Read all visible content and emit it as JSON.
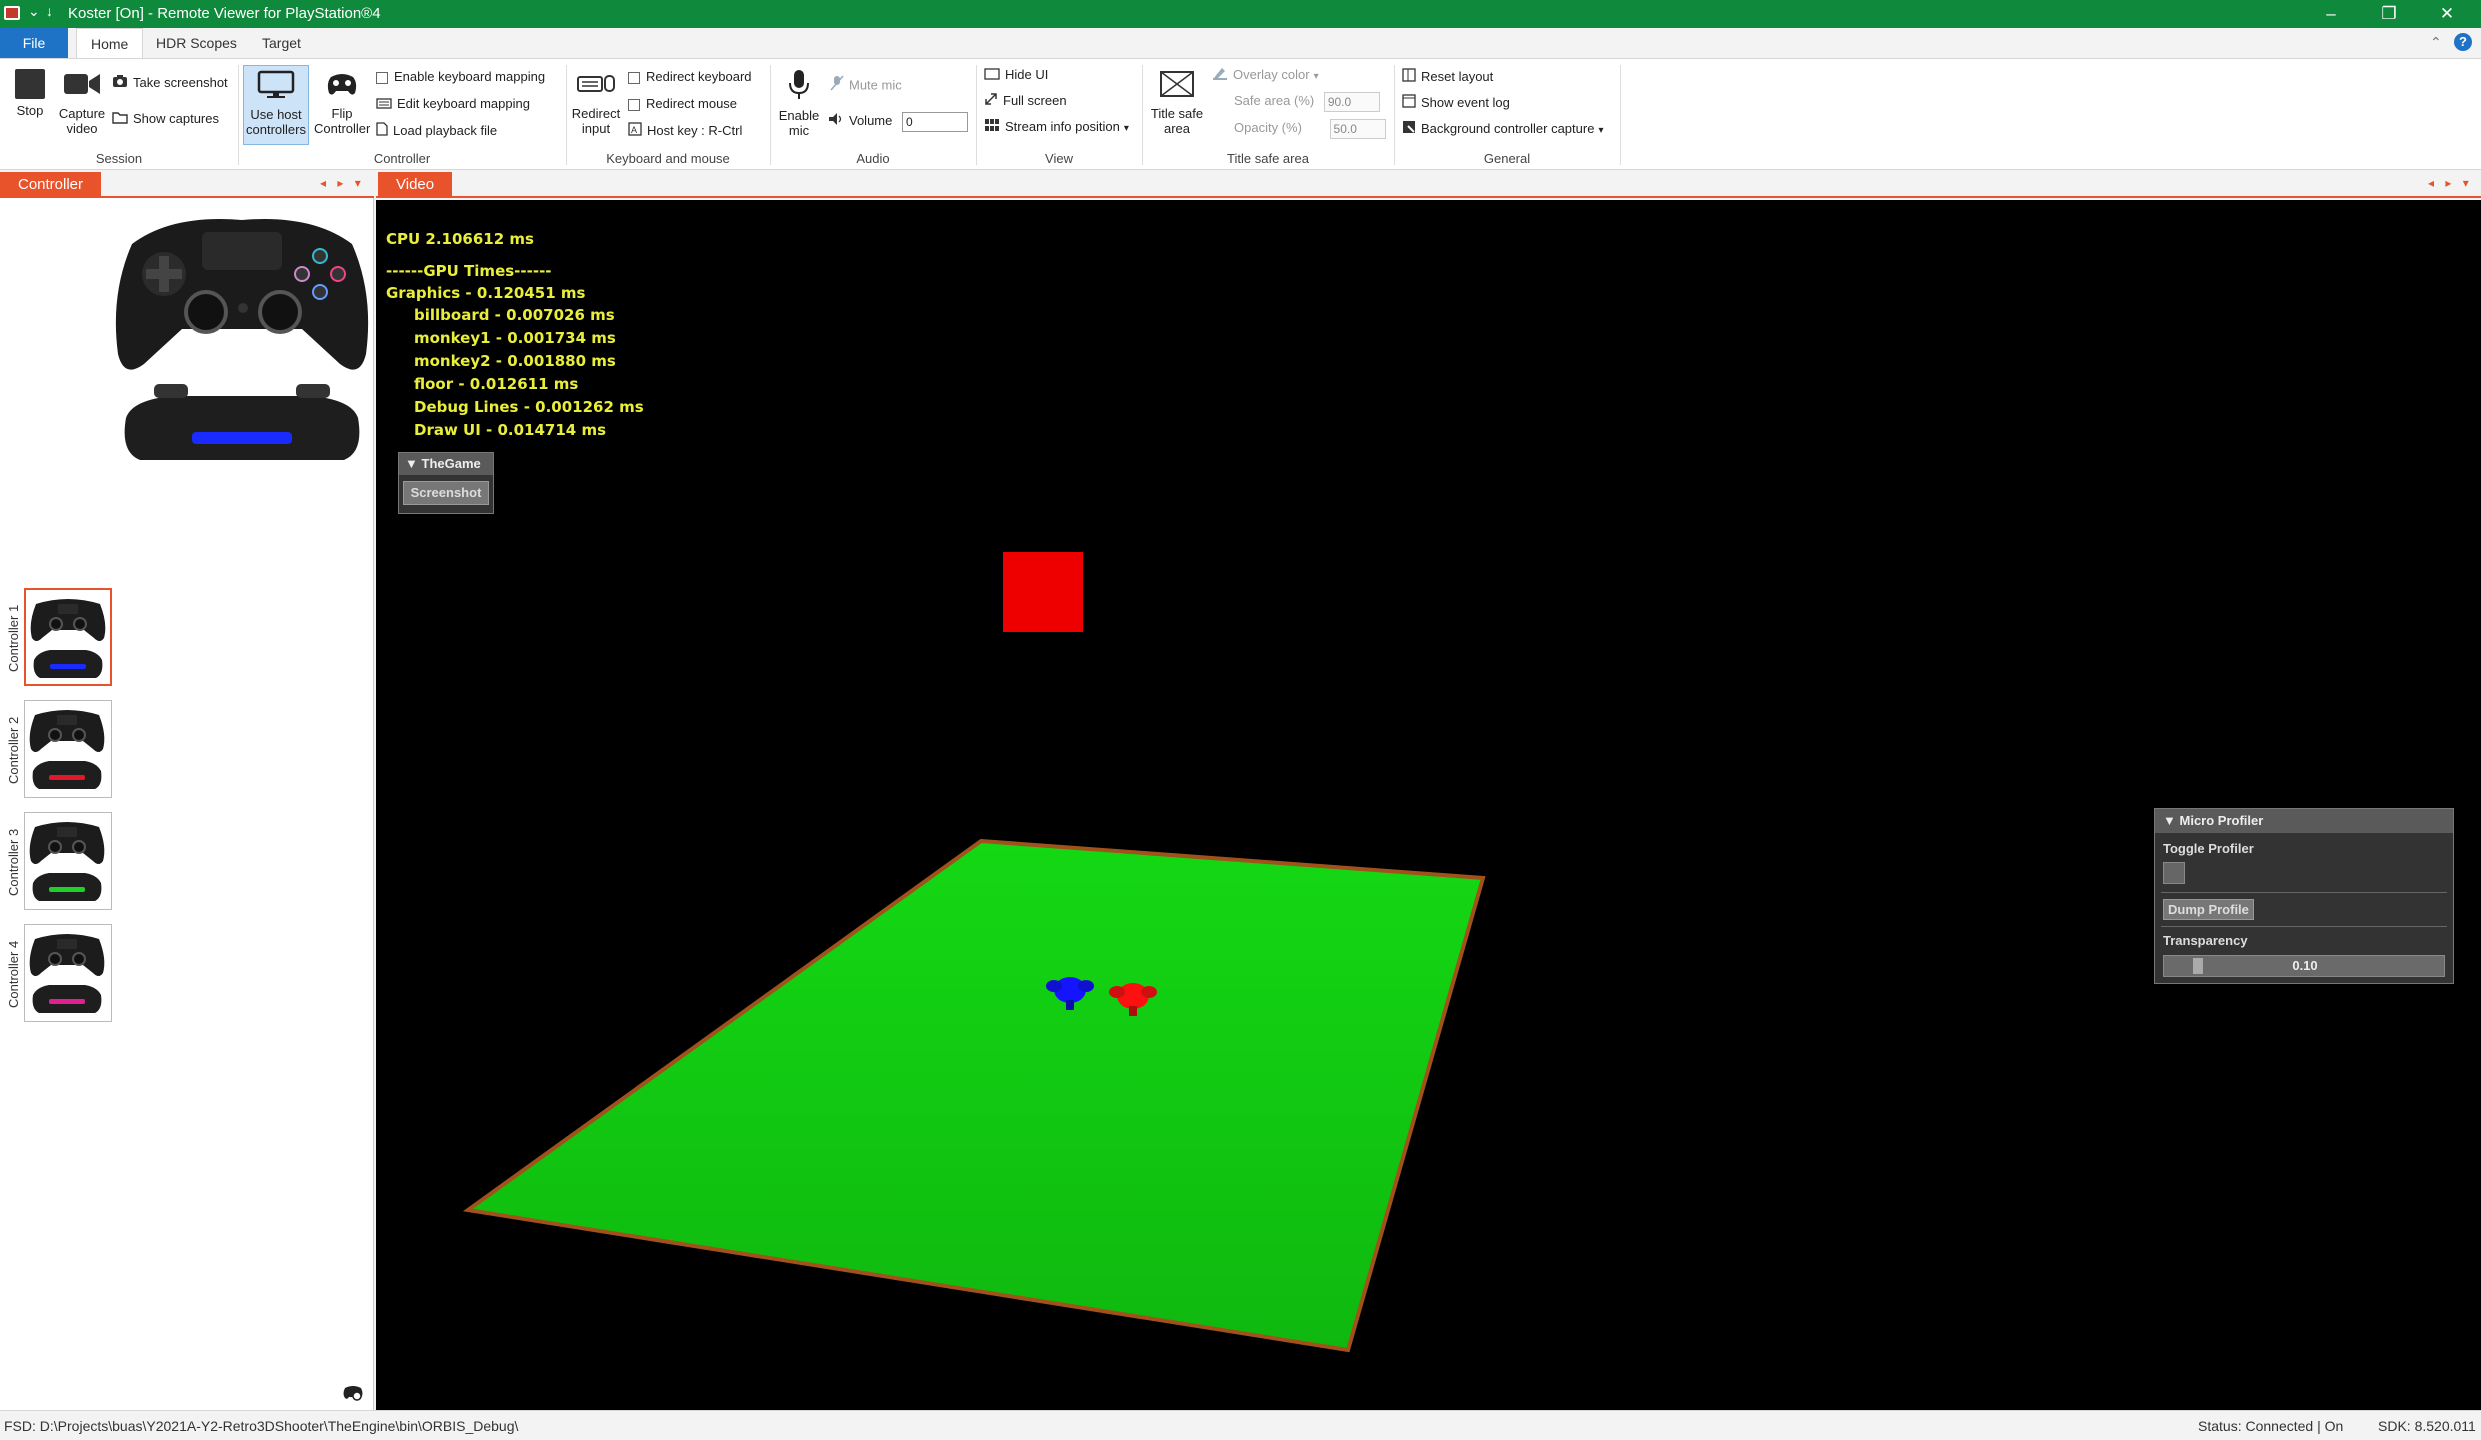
{
  "window": {
    "title": "Koster [On] - Remote Viewer for PlayStation®4",
    "quick_access": "⌄",
    "quick_access2": "↓"
  },
  "tabs": {
    "file": "File",
    "home": "Home",
    "hdr": "HDR Scopes",
    "target": "Target"
  },
  "ribbon": {
    "session": {
      "label": "Session",
      "stop": "Stop",
      "capture_video": "Capture video",
      "take_screenshot": "Take screenshot",
      "show_captures": "Show captures"
    },
    "controller": {
      "label": "Controller",
      "use_host": "Use host controllers",
      "flip": "Flip Controller",
      "enable_kb_map": "Enable keyboard mapping",
      "edit_kb_map": "Edit keyboard mapping",
      "load_playback": "Load playback file"
    },
    "kbm": {
      "label": "Keyboard and mouse",
      "redirect_input": "Redirect input",
      "redirect_keyboard": "Redirect keyboard",
      "redirect_mouse": "Redirect mouse",
      "host_key": "Host key : R-Ctrl"
    },
    "audio": {
      "label": "Audio",
      "enable_mic": "Enable mic",
      "mute_mic": "Mute mic",
      "volume_label": "Volume",
      "volume_value": "0"
    },
    "view": {
      "label": "View",
      "hide_ui": "Hide UI",
      "full_screen": "Full screen",
      "stream_info": "Stream info position"
    },
    "title_safe": {
      "label": "Title safe area",
      "button": "Title safe area",
      "overlay_color": "Overlay color",
      "safe_area_label": "Safe area (%)",
      "safe_area_value": "90.0",
      "opacity_label": "Opacity (%)",
      "opacity_value": "50.0"
    },
    "general": {
      "label": "General",
      "reset_layout": "Reset layout",
      "show_event_log": "Show event log",
      "bg_capture": "Background controller capture"
    }
  },
  "panels": {
    "controller_tab": "Controller",
    "video_tab": "Video",
    "controllers": [
      "Controller 1",
      "Controller 2",
      "Controller 3",
      "Controller 4"
    ],
    "lightbar_colors": [
      "#1a2bff",
      "#e0182a",
      "#1fcf2a",
      "#e0208f"
    ]
  },
  "overlay": {
    "cpu": "CPU 2.106612 ms",
    "gpu_header": "------GPU Times------",
    "graphics": "Graphics - 0.120451 ms",
    "items": [
      "billboard - 0.007026 ms",
      "monkey1 - 0.001734 ms",
      "monkey2 - 0.001880 ms",
      "floor - 0.012611 ms",
      "Debug Lines - 0.001262 ms",
      "Draw UI - 0.014714 ms"
    ],
    "game_panel_title": "TheGame",
    "screenshot_btn": "Screenshot",
    "profiler_title": "Micro Profiler",
    "toggle_profiler": "Toggle Profiler",
    "dump_profile": "Dump Profile",
    "transparency": "Transparency",
    "transparency_value": "0.10"
  },
  "statusbar": {
    "path": "FSD: D:\\Projects\\buas\\Y2021A-Y2-Retro3DShooter\\TheEngine\\bin\\ORBIS_Debug\\",
    "status": "Status: Connected | On",
    "sdk": "SDK: 8.520.011"
  },
  "colors": {
    "titlebar": "#0f8a3c",
    "accent": "#e8532b",
    "file_tab": "#1f73c7",
    "debug_text": "#e9ee3a",
    "floor": "#12d412",
    "cube": "#ee0000"
  }
}
